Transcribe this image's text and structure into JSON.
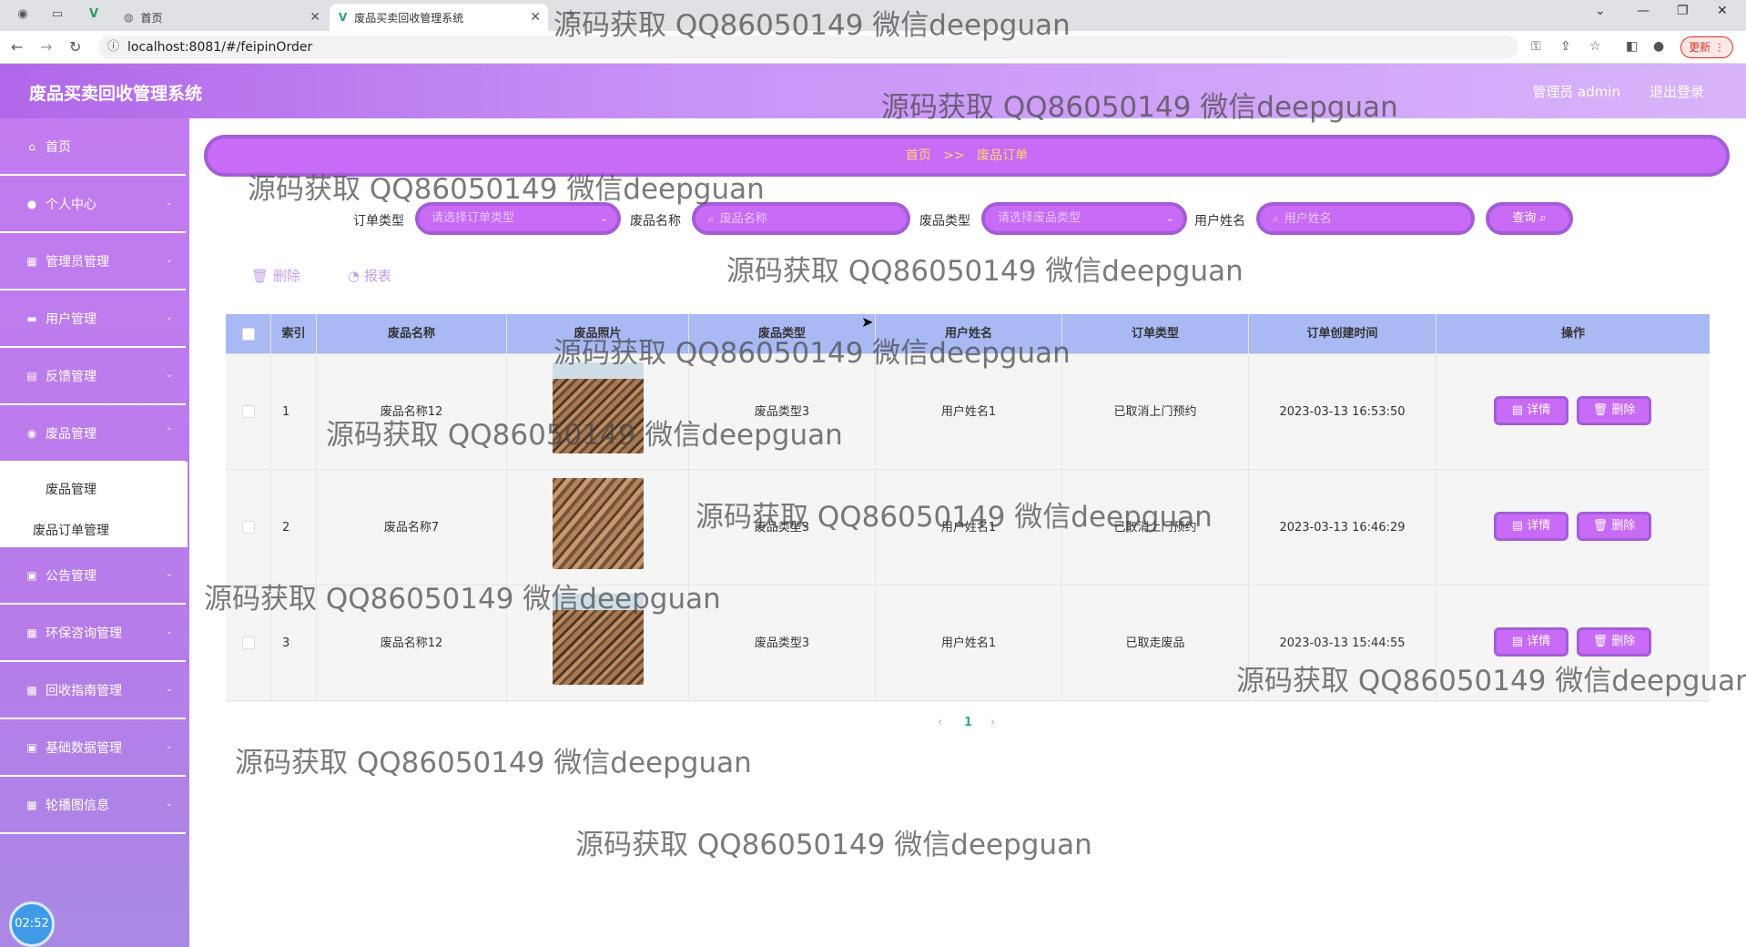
{
  "browser": {
    "tabs": [
      {
        "label": "首页"
      },
      {
        "label": "废品买卖回收管理系统"
      }
    ],
    "url": "localhost:8081/#/feipinOrder",
    "update_label": "更新"
  },
  "header": {
    "title": "废品买卖回收管理系统",
    "user": "管理员 admin",
    "logout": "退出登录"
  },
  "sidebar": {
    "items": [
      {
        "label": "首页",
        "icon": "home-icon"
      },
      {
        "label": "个人中心",
        "icon": "user-icon"
      },
      {
        "label": "管理员管理",
        "icon": "grid-icon"
      },
      {
        "label": "用户管理",
        "icon": "message-icon"
      },
      {
        "label": "反馈管理",
        "icon": "briefcase-icon"
      },
      {
        "label": "废品管理",
        "icon": "location-icon"
      },
      {
        "label": "公告管理",
        "icon": "document-icon"
      },
      {
        "label": "环保咨询管理",
        "icon": "grid-icon"
      },
      {
        "label": "回收指南管理",
        "icon": "ticket-icon"
      },
      {
        "label": "基础数据管理",
        "icon": "document-icon"
      },
      {
        "label": "轮播图信息",
        "icon": "grid-icon"
      }
    ],
    "submenu": [
      {
        "label": "废品管理"
      },
      {
        "label": "废品订单管理"
      }
    ],
    "clock": "02:52"
  },
  "breadcrumb": {
    "home": "首页",
    "separator": ">>",
    "current": "废品订单"
  },
  "search": {
    "order_type_label": "订单类型",
    "order_type_placeholder": "请选择订单类型",
    "name_label": "废品名称",
    "name_placeholder": "废品名称",
    "type_label": "废品类型",
    "type_placeholder": "请选择废品类型",
    "user_label": "用户姓名",
    "user_placeholder": "用户姓名",
    "query_button": "查询"
  },
  "actions": {
    "delete": "删除",
    "report": "报表"
  },
  "table": {
    "columns": [
      "索引",
      "废品名称",
      "废品照片",
      "废品类型",
      "用户姓名",
      "订单类型",
      "订单创建时间",
      "操作"
    ],
    "rows": [
      {
        "index": "1",
        "name": "废品名称12",
        "type": "废品类型3",
        "user": "用户姓名1",
        "order_type": "已取消上门预约",
        "created": "2023-03-13 16:53:50"
      },
      {
        "index": "2",
        "name": "废品名称7",
        "type": "废品类型3",
        "user": "用户姓名1",
        "order_type": "已取消上门预约",
        "created": "2023-03-13 16:46:29"
      },
      {
        "index": "3",
        "name": "废品名称12",
        "type": "废品类型3",
        "user": "用户姓名1",
        "order_type": "已取走废品",
        "created": "2023-03-13 15:44:55"
      }
    ],
    "detail_button": "详情",
    "delete_button": "删除"
  },
  "pagination": {
    "current_page": "1",
    "prev": "‹",
    "next": "›"
  },
  "watermark": "源码获取 QQ86050149 微信deepguan",
  "colors": {
    "accent": "#c86bf7",
    "accent_border": "#a35dd8",
    "header_start": "#b067e8",
    "table_header": "#a9b9f4",
    "breadcrumb_text": "#ffd76a"
  }
}
